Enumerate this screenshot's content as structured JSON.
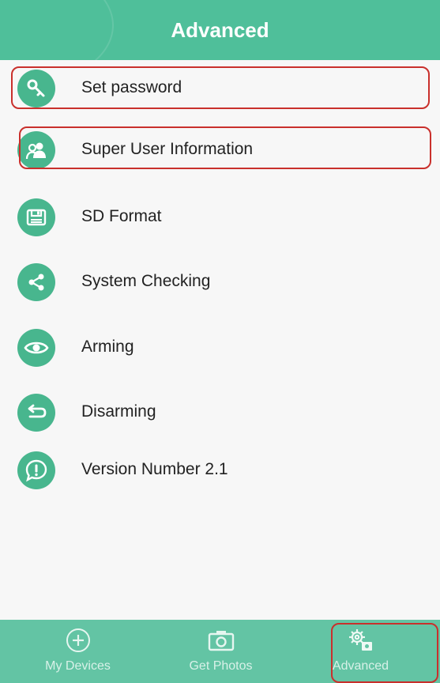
{
  "header": {
    "title": "Advanced"
  },
  "menu": {
    "items": [
      {
        "label": "Set password",
        "icon": "key-icon"
      },
      {
        "label": "Super User Information",
        "icon": "users-icon"
      },
      {
        "label": "SD Format",
        "icon": "sd-card-icon"
      },
      {
        "label": "System Checking",
        "icon": "share-icon"
      },
      {
        "label": "Arming",
        "icon": "eye-icon"
      },
      {
        "label": "Disarming",
        "icon": "undo-icon"
      },
      {
        "label": "Version Number 2.1",
        "icon": "info-bubble-icon"
      }
    ]
  },
  "tabbar": {
    "tabs": [
      {
        "label": "My Devices",
        "icon": "plus-circle-icon"
      },
      {
        "label": "Get Photos",
        "icon": "camera-icon"
      },
      {
        "label": "Advanced",
        "icon": "gears-icon",
        "active": true
      }
    ]
  },
  "colors": {
    "header": "#4fbf9a",
    "icon_bg": "#48b68e",
    "tabbar": "#63c4a4",
    "highlight": "#c9302c"
  }
}
